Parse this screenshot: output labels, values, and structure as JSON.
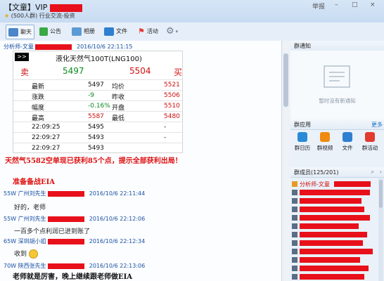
{
  "header": {
    "title_prefix": "【文童】VIP",
    "subtitle": "(500人群) 行业交流-投资",
    "window_controls": [
      "举报",
      "–",
      "□",
      "×"
    ]
  },
  "toolbar": {
    "items": [
      {
        "label": "聊天",
        "icon": "chat-icon",
        "active": true
      },
      {
        "label": "公告",
        "icon": "announcement-icon"
      },
      {
        "label": "相册",
        "icon": "album-icon"
      },
      {
        "label": "文件",
        "icon": "folder-icon"
      },
      {
        "label": "活动",
        "icon": "flag-icon"
      },
      {
        "label": "",
        "icon": "gear-icon"
      }
    ]
  },
  "quote": {
    "button": ">>",
    "name": "液化天然气100T(LNG100)",
    "sell_label": "卖",
    "sell_price": "5497",
    "buy_price": "5504",
    "buy_label": "买",
    "rows": [
      {
        "l": "最新",
        "v": "5497",
        "l2": "均价",
        "v2": "5521"
      },
      {
        "l": "涨跌",
        "v": "-9",
        "l2": "昨收",
        "v2": "5506"
      },
      {
        "l": "幅度",
        "v": "-0.16%",
        "l2": "开盘",
        "v2": "5510"
      },
      {
        "l": "最高",
        "v": "5587",
        "l2": "最低",
        "v2": "5480"
      },
      {
        "l": "22:09:25",
        "v": "5495",
        "l2": "",
        "v2": "-"
      },
      {
        "l": "22:09:27",
        "v": "5493",
        "l2": "",
        "v2": "-"
      },
      {
        "l": "22:09:27",
        "v": "5493",
        "l2": "",
        "v2": ""
      }
    ]
  },
  "messages": {
    "first_sender": "分析师-文童",
    "first_time": "2016/10/6 22:11:15",
    "red1": "天然气5582空单现已获利85个点，提示全部获利出局！",
    "red2": "准备备战EIA",
    "m1_sender": "55W 广州刘先生",
    "m1_time": "2016/10/6 22:11:44",
    "m1_text": "好的，老师",
    "m2_sender": "55W 广州刘先生",
    "m2_time": "2016/10/6 22:12:06",
    "m2_text": "一百多个点利润已进到账了",
    "m3_sender": "65W 深圳胡小姐",
    "m3_time": "2016/10/6 22:12:34",
    "m3_text": "收到",
    "m4_sender": "70W 陕西张先生",
    "m4_time": "2016/10/6 22:13:06",
    "m4_text": "老师就是厉害，晚上继续跟老师做EIA"
  },
  "right": {
    "notice_title": "群通知",
    "notice_empty": "暂时没有新通知",
    "apps_title": "群应用",
    "apps_more": "更多",
    "apps": [
      {
        "label": "群日历",
        "color": "#2a8ad8"
      },
      {
        "label": "群视频",
        "color": "#f08a10"
      },
      {
        "label": "文件",
        "color": "#2f7fd0"
      },
      {
        "label": "群活动",
        "color": "#e23a30"
      }
    ],
    "members_title": "群成员(125/201)",
    "first_member": "分析师-文童"
  },
  "colors": {
    "red": "#e01010",
    "sender_blue": "#1a4fa0",
    "redact": "#e8101a"
  }
}
